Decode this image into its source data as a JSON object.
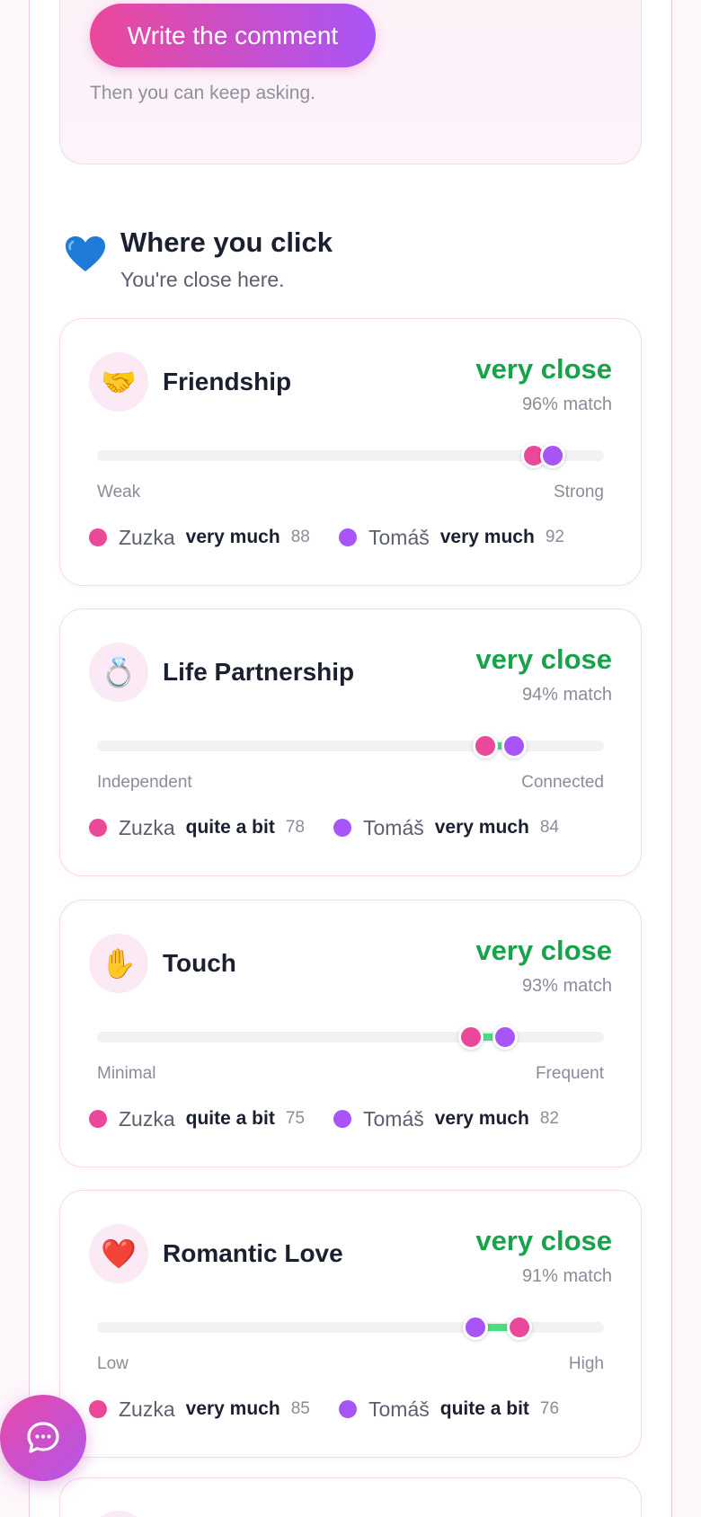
{
  "cta": {
    "button_label": "Write the comment",
    "hint": "Then you can keep asking."
  },
  "section": {
    "icon": "blue-heart-icon",
    "title": "Where you click",
    "subtitle": "You're close here."
  },
  "people": {
    "a": {
      "name": "Zuzka",
      "color": "#ec4899"
    },
    "b": {
      "name": "Tomáš",
      "color": "#a855f7"
    }
  },
  "colors": {
    "accent_pink": "#ec4899",
    "accent_purple": "#a855f7",
    "level_green": "#16a34a",
    "gap_green": "#4ade80"
  },
  "cards": [
    {
      "icon": "handshake-icon",
      "glyph": "🤝",
      "title": "Friendship",
      "level": "very close",
      "match": "96% match",
      "scale_low": "Weak",
      "scale_high": "Strong",
      "a": {
        "level": "very much",
        "score": "88"
      },
      "b": {
        "level": "very much",
        "score": "92"
      }
    },
    {
      "icon": "ring-icon",
      "glyph": "💍",
      "title": "Life Partnership",
      "level": "very close",
      "match": "94% match",
      "scale_low": "Independent",
      "scale_high": "Connected",
      "a": {
        "level": "quite a bit",
        "score": "78"
      },
      "b": {
        "level": "very much",
        "score": "84"
      }
    },
    {
      "icon": "raised-hand-icon",
      "glyph": "✋",
      "title": "Touch",
      "level": "very close",
      "match": "93% match",
      "scale_low": "Minimal",
      "scale_high": "Frequent",
      "a": {
        "level": "quite a bit",
        "score": "75"
      },
      "b": {
        "level": "very much",
        "score": "82"
      }
    },
    {
      "icon": "red-heart-icon",
      "glyph": "❤️",
      "title": "Romantic Love",
      "level": "very close",
      "match": "91% match",
      "scale_low": "Low",
      "scale_high": "High",
      "a": {
        "level": "very much",
        "score": "85"
      },
      "b": {
        "level": "quite a bit",
        "score": "76"
      }
    }
  ],
  "chat_button": {
    "icon": "chat-bubble-icon"
  }
}
